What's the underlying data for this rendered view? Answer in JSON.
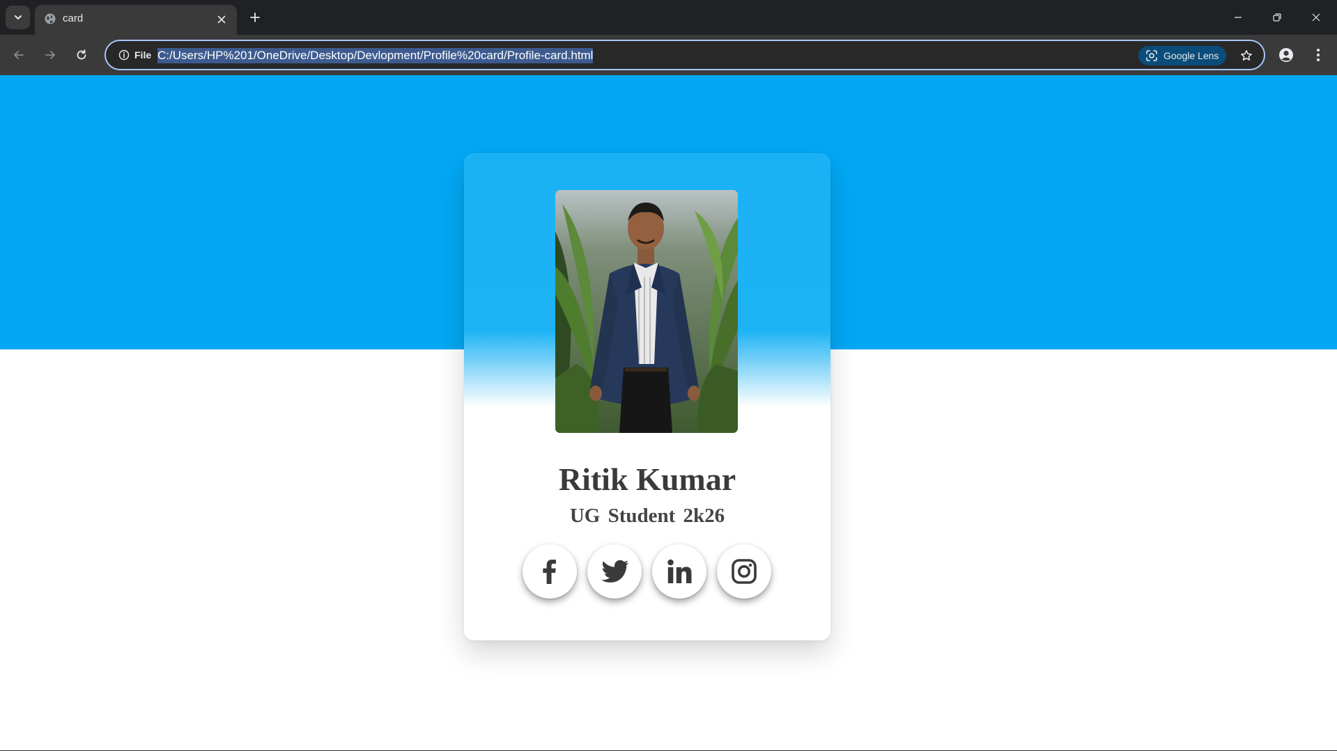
{
  "browser": {
    "tab": {
      "title": "card",
      "favicon": "globe-icon"
    },
    "address_bar": {
      "site_info_label": "File",
      "url": "C:/Users/HP%201/OneDrive/Desktop/Devlopment/Profile%20card/Profile-card.html",
      "lens_label": "Google Lens"
    },
    "icons": {
      "tab_list": "chevron-down-icon",
      "tab_close": "close-icon",
      "new_tab": "plus-icon",
      "back": "back-arrow-icon",
      "forward": "forward-arrow-icon",
      "reload": "reload-icon",
      "info": "info-icon",
      "lens": "lens-icon",
      "bookmark": "star-icon",
      "profile": "profile-icon",
      "menu": "kebab-menu-icon",
      "minimize": "minimize-icon",
      "restore": "restore-icon",
      "close_window": "close-icon"
    }
  },
  "page": {
    "colors": {
      "band": "#03a7f3",
      "card_top": "#1bb2f5",
      "text": "#3a3a3a"
    },
    "profile": {
      "name": "Ritik Kumar",
      "role": "UG Student  2k26",
      "photo": "profile-photo"
    },
    "socials": [
      {
        "name": "facebook",
        "icon": "facebook-icon"
      },
      {
        "name": "twitter",
        "icon": "twitter-icon"
      },
      {
        "name": "linkedin",
        "icon": "linkedin-icon"
      },
      {
        "name": "instagram",
        "icon": "instagram-icon"
      }
    ]
  }
}
